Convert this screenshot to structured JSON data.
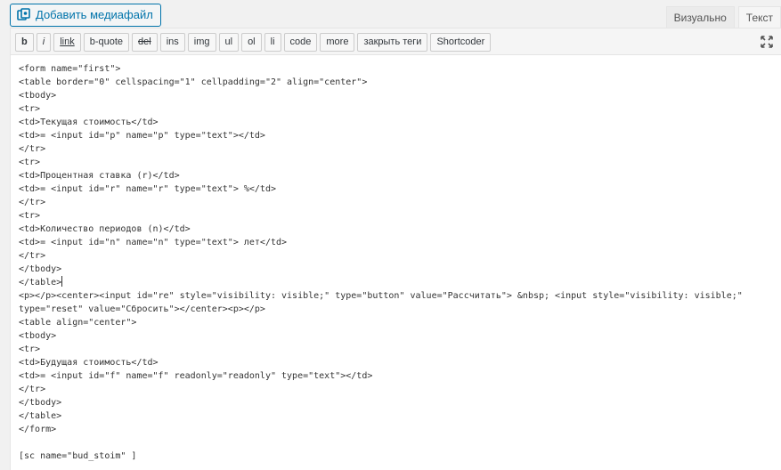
{
  "media_button": {
    "label": "Добавить медиафайл",
    "icon": "media-icon"
  },
  "tabs": [
    {
      "label": "Визуально",
      "active": false
    },
    {
      "label": "Текст",
      "active": true
    }
  ],
  "toolbar": {
    "buttons": [
      "b",
      "i",
      "link",
      "b-quote",
      "del",
      "ins",
      "img",
      "ul",
      "ol",
      "li",
      "code",
      "more",
      "закрыть теги",
      "Shortcoder"
    ],
    "expand_icon": "fullscreen-expand-icon"
  },
  "code_lines": [
    "<form name=\"first\">",
    "<table border=\"0\" cellspacing=\"1\" cellpadding=\"2\" align=\"center\">",
    "<tbody>",
    "<tr>",
    "<td>Текущая стоимость</td>",
    "<td>= <input id=\"p\" name=\"p\" type=\"text\"></td>",
    "</tr>",
    "<tr>",
    "<td>Процентная ставка (r)</td>",
    "<td>= <input id=\"r\" name=\"r\" type=\"text\"> %</td>",
    "</tr>",
    "<tr>",
    "<td>Количество периодов (n)</td>",
    "<td>= <input id=\"n\" name=\"n\" type=\"text\"> лет</td>",
    "</tr>",
    "</tbody>",
    "</table>",
    "<p></p><center><input id=\"re\" style=\"visibility: visible;\" type=\"button\" value=\"Рассчитать\"> &nbsp; <input style=\"visibility: visible;\"",
    "type=\"reset\" value=\"Сбросить\"></center><p></p>",
    "<table align=\"center\">",
    "<tbody>",
    "<tr>",
    "<td>Будущая стоимость</td>",
    "<td>= <input id=\"f\" name=\"f\" readonly=\"readonly\" type=\"text\"></td>",
    "</tr>",
    "</tbody>",
    "</table>",
    "</form>",
    "",
    "[sc name=\"bud_stoim\" ]"
  ]
}
